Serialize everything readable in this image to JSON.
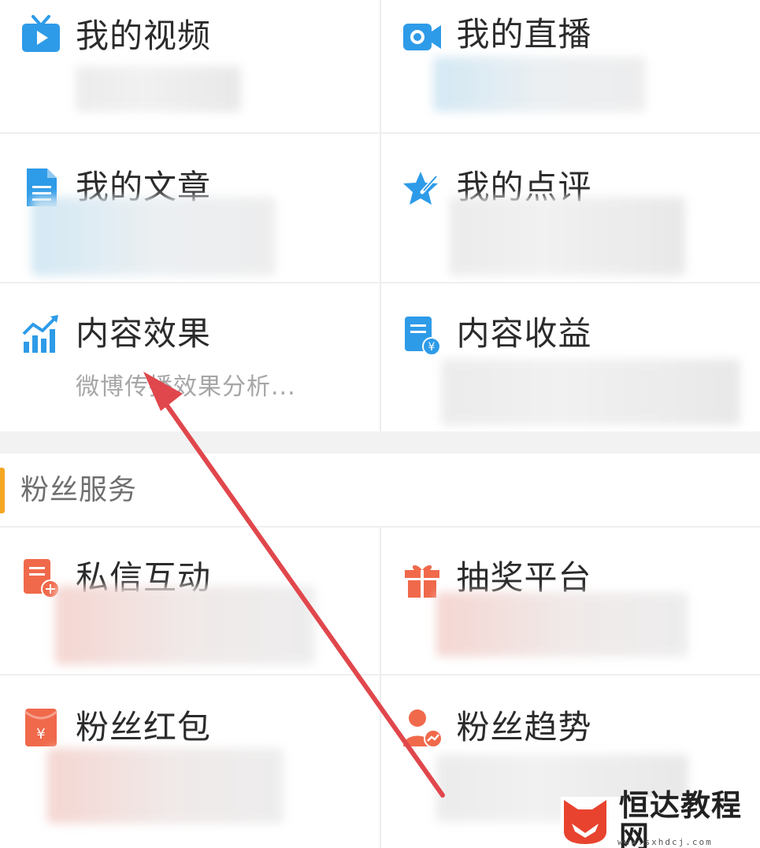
{
  "colors": {
    "blue_accent": "#2e9be8",
    "orange_accent": "#f0694b",
    "section_bar": "#f5a623",
    "arrow": "#e0474c"
  },
  "tiles_creator": [
    {
      "title": "我的视频",
      "icon": "tv-icon"
    },
    {
      "title": "我的直播",
      "icon": "camera-icon"
    },
    {
      "title": "我的文章",
      "icon": "document-icon"
    },
    {
      "title": "我的点评",
      "icon": "star-pen-icon"
    },
    {
      "title": "内容效果",
      "subtitle": "微博传播效果分析...",
      "icon": "bar-chart-icon"
    },
    {
      "title": "内容收益",
      "icon": "income-document-icon"
    }
  ],
  "fan_section": {
    "title": "粉丝服务"
  },
  "tiles_fans": [
    {
      "title": "私信互动",
      "icon": "message-doc-icon"
    },
    {
      "title": "抽奖平台",
      "icon": "gift-icon"
    },
    {
      "title": "粉丝红包",
      "icon": "red-envelope-icon"
    },
    {
      "title": "粉丝趋势",
      "icon": "user-trend-icon"
    }
  ],
  "watermark": {
    "brand": "恒达教程网",
    "url": "www.sxhdcj.com"
  }
}
